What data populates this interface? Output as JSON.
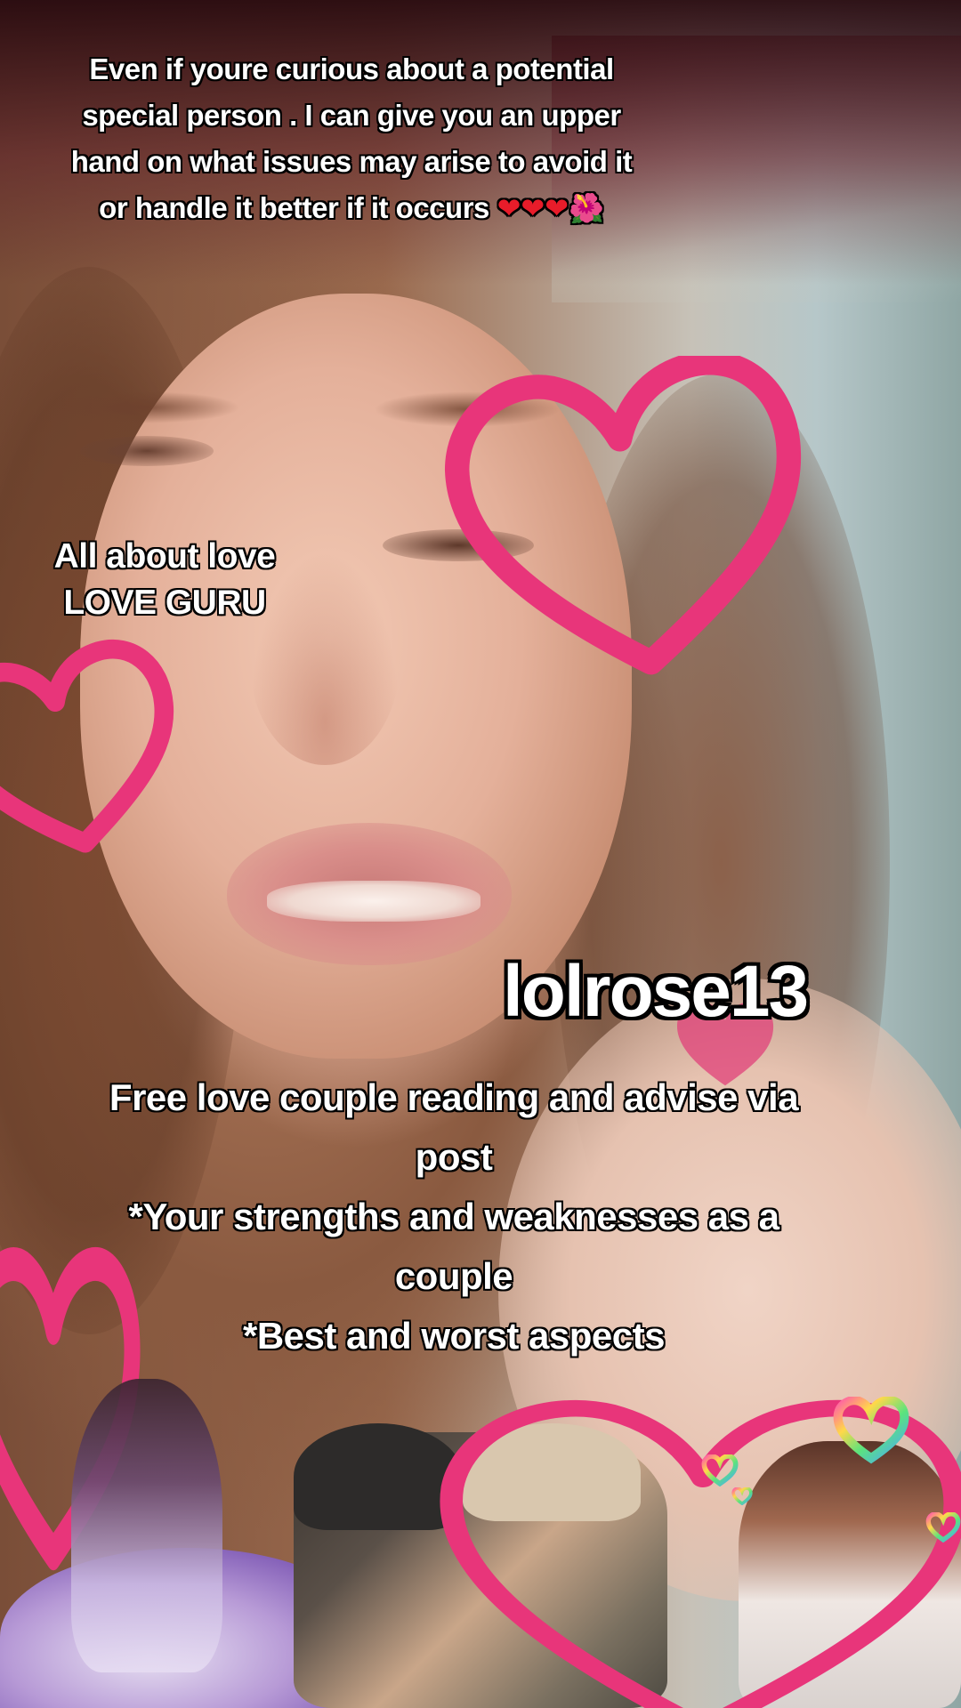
{
  "top_caption": {
    "lines": [
      "Even if youre  curious about a potential",
      "special person . I can give you an upper",
      "hand on what issues may arise to avoid it",
      "or handle it better if it occurs"
    ],
    "emojis": [
      "❤",
      "❤",
      "❤",
      "🌺"
    ]
  },
  "left_caption": {
    "line1": "All about love",
    "line2": "LOVE GURU"
  },
  "username": "lolrose13",
  "body_caption": {
    "lines": [
      "Free love couple reading and advise via",
      "post",
      "*Your strengths and weaknesses as a",
      "couple",
      "*Best and worst aspects"
    ]
  },
  "colors": {
    "heart_pink": "#e8357a",
    "text": "#ffffff",
    "outline": "#000000"
  },
  "icons": [
    "heart-outline-icon",
    "rainbow-heart-icon",
    "red-heart-emoji",
    "hibiscus-emoji"
  ]
}
